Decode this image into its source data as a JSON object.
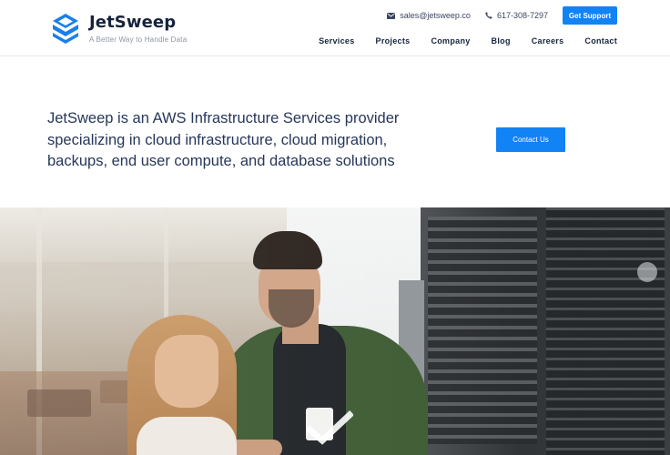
{
  "brand": {
    "name": "JetSweep",
    "tagline": "A Better Way to Handle Data"
  },
  "contact": {
    "email": "sales@jetsweep.co",
    "phone": "617-308-7297",
    "support_label": "Get Support"
  },
  "nav": {
    "items": [
      "Services",
      "Projects",
      "Company",
      "Blog",
      "Careers",
      "Contact"
    ]
  },
  "hero": {
    "lines": [
      "JetSweep is an AWS Infrastructure Services provider",
      "specializing in cloud infrastructure, cloud migration,",
      "backups, end user compute, and database solutions"
    ],
    "cta_label": "Contact Us"
  },
  "colors": {
    "accent": "#1183f5",
    "brand_dark": "#17233d",
    "text": "#27375a"
  },
  "icons": [
    "jetsweep-logo-icon",
    "envelope-icon",
    "phone-icon"
  ]
}
